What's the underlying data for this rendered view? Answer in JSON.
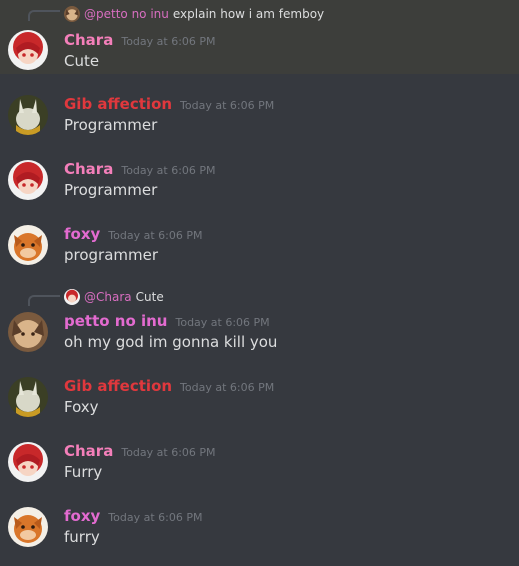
{
  "colors": {
    "background": "#36393f",
    "highlight": "#3d3e3b",
    "chara": "#f47fba",
    "gib": "#e0383d",
    "foxy": "#e36bd0",
    "petto": "#e36bd0",
    "text": "#dcddde",
    "timestamp": "#72767d"
  },
  "messages": [
    {
      "author": "Chara",
      "timestamp": "Today at 6:06 PM",
      "content": "Cute",
      "avatar_icon": "chara-avatar-icon",
      "reply": {
        "mention": "@petto no inu",
        "text": "explain how i am femboy",
        "avatar_icon": "petto-avatar-icon"
      }
    },
    {
      "author": "Gib affection",
      "timestamp": "Today at 6:06 PM",
      "content": "Programmer",
      "avatar_icon": "gib-avatar-icon"
    },
    {
      "author": "Chara",
      "timestamp": "Today at 6:06 PM",
      "content": "Programmer",
      "avatar_icon": "chara-avatar-icon"
    },
    {
      "author": "foxy",
      "timestamp": "Today at 6:06 PM",
      "content": "programmer",
      "avatar_icon": "foxy-avatar-icon"
    },
    {
      "author": "petto no inu",
      "timestamp": "Today at 6:06 PM",
      "content": "oh my god im gonna kill you",
      "avatar_icon": "petto-avatar-icon",
      "reply": {
        "mention": "@Chara",
        "text": "Cute",
        "avatar_icon": "chara-avatar-icon"
      }
    },
    {
      "author": "Gib affection",
      "timestamp": "Today at 6:06 PM",
      "content": "Foxy",
      "avatar_icon": "gib-avatar-icon"
    },
    {
      "author": "Chara",
      "timestamp": "Today at 6:06 PM",
      "content": "Furry",
      "avatar_icon": "chara-avatar-icon"
    },
    {
      "author": "foxy",
      "timestamp": "Today at 6:06 PM",
      "content": "furry",
      "avatar_icon": "foxy-avatar-icon"
    }
  ]
}
